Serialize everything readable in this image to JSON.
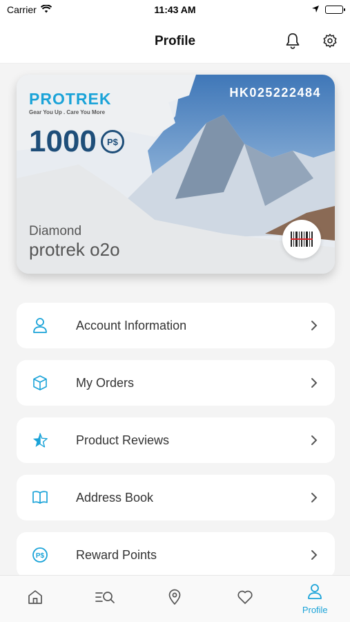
{
  "status": {
    "carrier": "Carrier",
    "time": "11:43 AM"
  },
  "nav": {
    "title": "Profile"
  },
  "card": {
    "brand": "PROTREK",
    "tagline": "Gear You Up . Care You More",
    "points": "1000",
    "points_unit": "P$",
    "card_number": "HK025222484",
    "tier": "Diamond",
    "holder": "protrek o2o"
  },
  "menu": [
    {
      "label": "Account Information",
      "icon": "user-icon"
    },
    {
      "label": "My Orders",
      "icon": "box-icon"
    },
    {
      "label": "Product Reviews",
      "icon": "star-icon"
    },
    {
      "label": "Address Book",
      "icon": "book-icon"
    },
    {
      "label": "Reward Points",
      "icon": "points-icon",
      "icon_text": "P$"
    }
  ],
  "tabs": [
    {
      "name": "home",
      "icon": "home-icon"
    },
    {
      "name": "search",
      "icon": "search-list-icon"
    },
    {
      "name": "location",
      "icon": "location-pin-icon"
    },
    {
      "name": "favorites",
      "icon": "heart-icon"
    },
    {
      "name": "profile",
      "icon": "profile-icon",
      "label": "Profile",
      "active": true
    }
  ],
  "colors": {
    "accent": "#1aa3d8",
    "navy": "#1e4e79"
  }
}
